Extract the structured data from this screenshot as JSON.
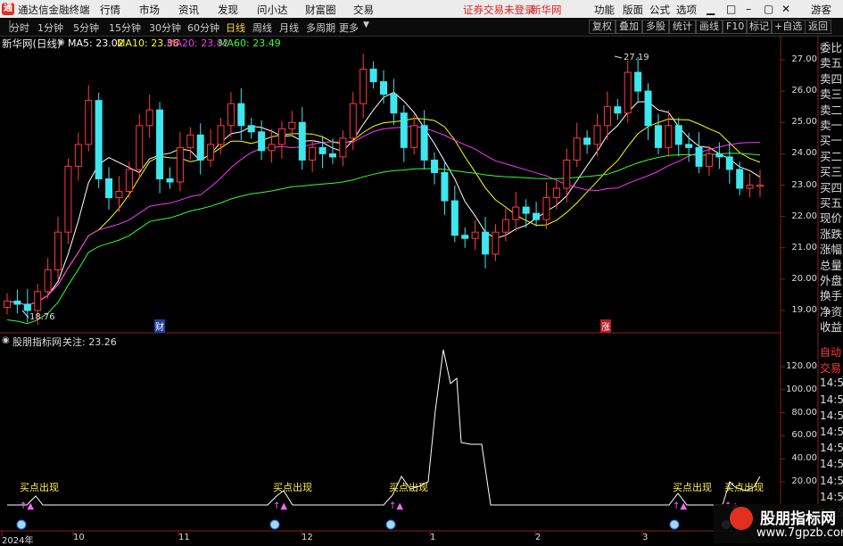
{
  "app": {
    "logo": "通",
    "title": "通达信金融终端",
    "menu": [
      "行情",
      "市场",
      "资讯",
      "发现",
      "问小达",
      "财富圈",
      "交易"
    ],
    "notice": "证券交易未登录",
    "broker": "新华网",
    "right_menu": [
      "功能",
      "版面",
      "公式",
      "选项"
    ],
    "guest": "游客"
  },
  "toolbar": {
    "periods": [
      "分时",
      "1分钟",
      "5分钟",
      "15分钟",
      "30分钟",
      "60分钟",
      "日线",
      "周线",
      "月线",
      "多周期",
      "更多"
    ],
    "selected": "日线",
    "right_buttons": [
      "复权",
      "叠加",
      "多股",
      "统计",
      "画线",
      "F10",
      "标记",
      "+自选",
      "返回"
    ]
  },
  "main_chart": {
    "stock_label": "新华网(日线)",
    "ma": [
      {
        "name": "MA5",
        "value": "23.02",
        "color": "#ffffff"
      },
      {
        "name": "MA10",
        "value": "23.36",
        "color": "#ffff00"
      },
      {
        "name": "MA20",
        "value": "23.82",
        "color": "#ff33ff"
      },
      {
        "name": "MA60",
        "value": "23.49",
        "color": "#33ff33"
      }
    ],
    "price_ticks": [
      "27.00",
      "26.00",
      "25.00",
      "24.00",
      "23.00",
      "22.00",
      "21.00",
      "20.00",
      "19.00"
    ],
    "high_annotation": "27.19",
    "low_annotation": "18.76",
    "markers": [
      "财",
      "涨"
    ]
  },
  "indicator": {
    "title": "股朋指标网",
    "focus_label": "关注:",
    "focus_value": "23.26",
    "ticks": [
      "120.00",
      "100.00",
      "80.00",
      "60.00",
      "40.00",
      "20.00"
    ],
    "signal_text": "买点出现"
  },
  "side_panel": {
    "quote_rows": [
      "委比",
      "卖五",
      "卖四",
      "卖三",
      "卖二",
      "卖一",
      "买一",
      "买二",
      "买三",
      "买四",
      "买五",
      "现价",
      "涨跌",
      "涨幅",
      "总量",
      "外盘",
      "换手",
      "净资",
      "收益"
    ],
    "lower_rows": [
      "自动",
      "交易",
      "14:56",
      "14:56",
      "14:56",
      "14:56",
      "14:56",
      "14:56",
      "14:56",
      "14:56",
      "14:56"
    ]
  },
  "x_axis": {
    "dates": [
      "2024年",
      "10",
      "11",
      "12",
      "1",
      "2",
      "3"
    ]
  },
  "watermark": {
    "title": "股朋指标网",
    "url": "www.7gpzb.com"
  },
  "chart_data": {
    "type": "candlestick",
    "title": "新华网(日线)",
    "ylim": [
      18.5,
      27.3
    ],
    "x": [
      "2024-09",
      "2024-10",
      "2024-11",
      "2024-12",
      "2025-01",
      "2025-02",
      "2025-03"
    ],
    "ohlc_key_points": [
      {
        "label": "low",
        "value": 18.76
      },
      {
        "label": "high",
        "value": 27.19
      }
    ],
    "series": [
      {
        "name": "MA5",
        "last": 23.02
      },
      {
        "name": "MA10",
        "last": 23.36
      },
      {
        "name": "MA20",
        "last": 23.82
      },
      {
        "name": "MA60",
        "last": 23.49
      }
    ],
    "close_series": [
      19.3,
      19.2,
      19.0,
      19.6,
      20.3,
      21.5,
      23.6,
      24.3,
      25.7,
      23.2,
      22.6,
      22.8,
      23.5,
      24.9,
      25.4,
      23.2,
      23.1,
      24.2,
      24.6,
      23.8,
      24.3,
      24.9,
      25.6,
      24.9,
      24.7,
      24.1,
      24.3,
      24.8,
      25.0,
      23.8,
      24.2,
      24.0,
      23.9,
      24.5,
      25.6,
      26.7,
      26.3,
      25.9,
      25.3,
      24.2,
      24.9,
      23.8,
      23.4,
      22.5,
      21.4,
      21.3,
      21.5,
      20.8,
      21.5,
      21.9,
      22.3,
      22.1,
      21.9,
      22.6,
      22.9,
      23.8,
      24.5,
      24.3,
      24.9,
      25.5,
      25.3,
      26.6,
      26.0,
      24.9,
      24.2,
      24.9,
      24.3,
      24.2,
      23.6,
      24.0,
      23.9,
      23.5,
      22.9,
      23.0,
      23.0
    ]
  }
}
